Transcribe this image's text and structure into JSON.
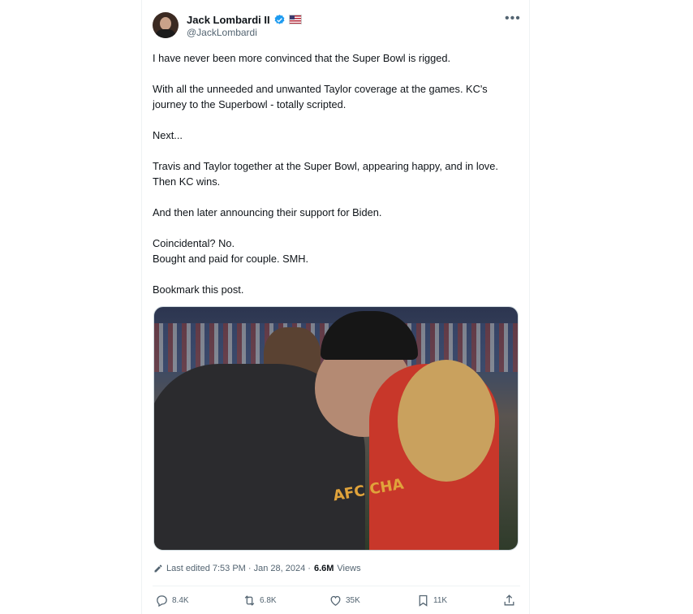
{
  "author": {
    "name": "Jack Lombardi II",
    "handle": "@JackLombardi",
    "verified_icon": "verified-badge-icon",
    "flag_icon": "us-flag-icon"
  },
  "tweet": {
    "text": "I have never been more convinced that the Super Bowl is rigged.\n\nWith all the unneeded and unwanted Taylor coverage at the games.  KC's journey to the Superbowl - totally scripted.\n\nNext...\n\nTravis and Taylor together at the Super Bowl, appearing happy, and in love. Then KC wins.\n\nAnd then later announcing their support for Biden.\n\nCoincidental?  No.\nBought and paid for couple.  SMH.\n\nBookmark this post.",
    "edited_label": "Last edited 7:53 PM · Jan 28, 2024 ·",
    "views_count": "6.6M",
    "views_label": "Views"
  },
  "actions": {
    "replies": "8.4K",
    "reposts": "6.8K",
    "likes": "35K",
    "bookmarks": "11K"
  },
  "colors": {
    "verified_blue": "#1d9bf0",
    "text": "#0f1419",
    "secondary": "#536471",
    "border": "#eff3f4"
  }
}
